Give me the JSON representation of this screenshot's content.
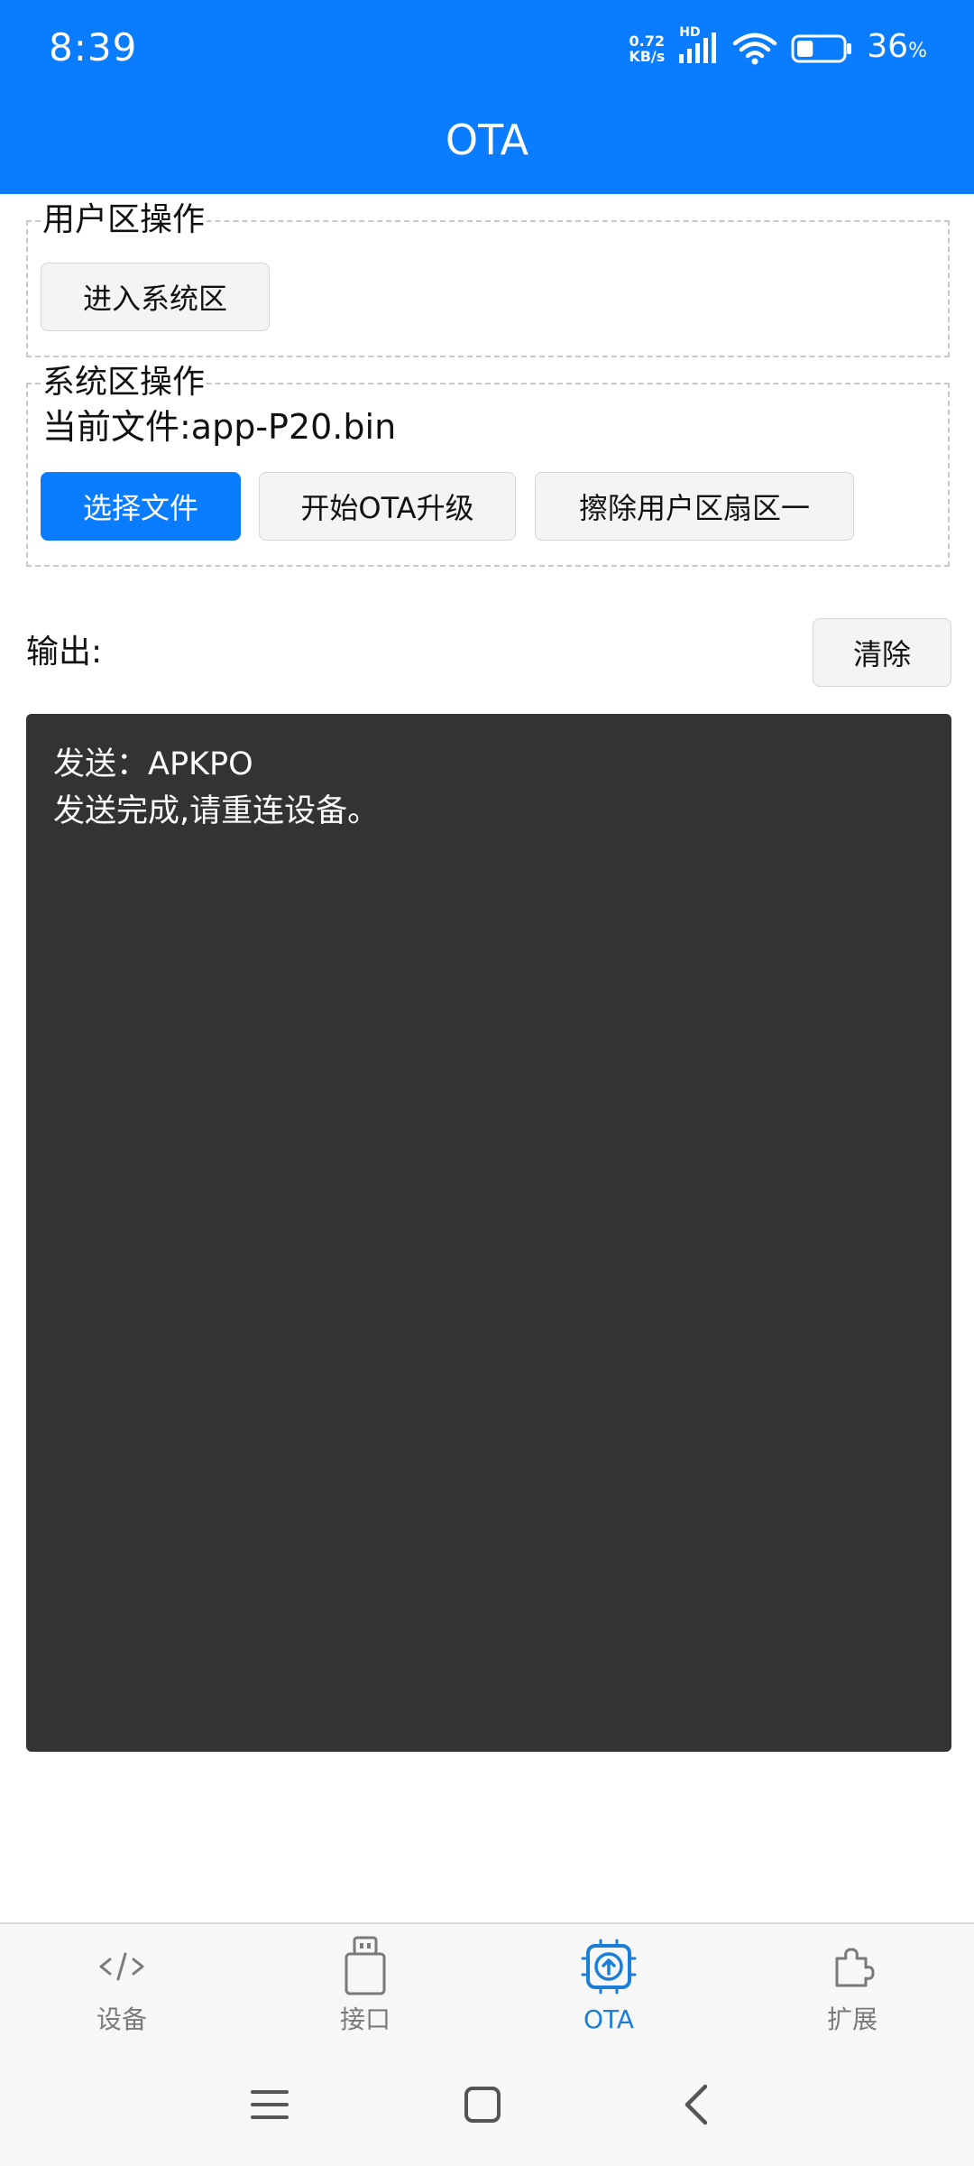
{
  "status_bar": {
    "time": "8:39",
    "net_speed_value": "0.72",
    "net_speed_unit": "KB/s",
    "hd_badge": "HD",
    "battery_percent": "36",
    "battery_suffix": "%",
    "battery_level": 0.36,
    "icons": [
      "signal-icon",
      "wifi-icon",
      "battery-icon"
    ]
  },
  "header": {
    "title": "OTA",
    "color": "#0a7cff"
  },
  "user_section": {
    "legend": "用户区操作",
    "enter_system_button": "进入系统区"
  },
  "system_section": {
    "legend": "系统区操作",
    "current_file": "当前文件:app-P20.bin",
    "buttons": {
      "select_file": "选择文件",
      "start_ota": "开始OTA升级",
      "erase_user_sector": "擦除用户区扇区一"
    }
  },
  "output": {
    "label": "输出:",
    "clear_button": "清除",
    "lines": [
      "发送：APKPO",
      "发送完成,请重连设备。"
    ],
    "background": "#333333"
  },
  "bottom_nav": {
    "items": [
      {
        "label": "设备",
        "icon": "code-icon",
        "active": false
      },
      {
        "label": "接口",
        "icon": "usb-icon",
        "active": false
      },
      {
        "label": "OTA",
        "icon": "chip-upload-icon",
        "active": true
      },
      {
        "label": "扩展",
        "icon": "puzzle-icon",
        "active": false
      }
    ],
    "active_color": "#1a7fd8"
  },
  "system_nav": {
    "icons": [
      "menu-icon",
      "home-icon",
      "back-icon"
    ]
  }
}
